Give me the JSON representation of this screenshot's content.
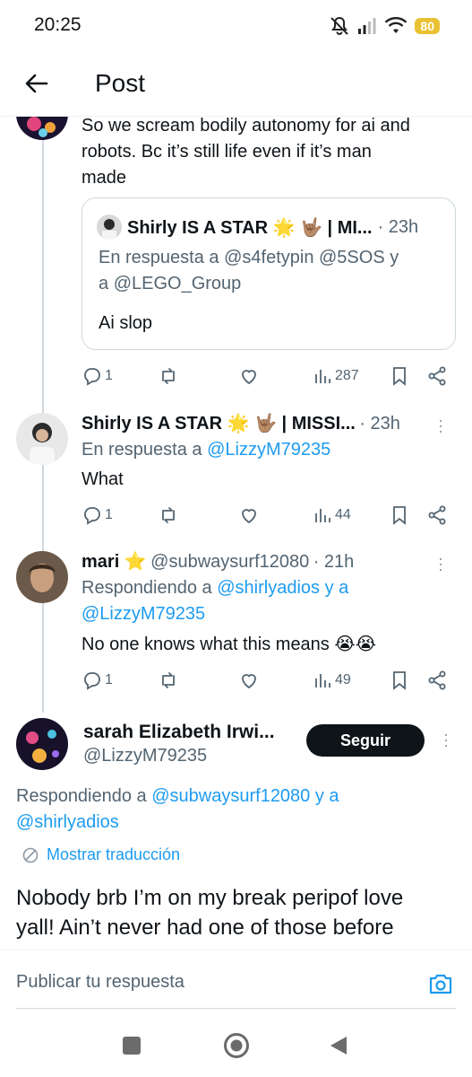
{
  "status": {
    "time": "20:25",
    "battery": "80"
  },
  "header": {
    "title": "Post"
  },
  "tweet1": {
    "text_line1": "So we scream bodily autonomy for ai and",
    "text_line2": "robots. Bc it’s still life even if it’s man",
    "text_line3": "made",
    "quote": {
      "name": "Shirly IS A STAR 🌟 🤟🏽 | MI...",
      "time": "· 23h",
      "reply_prefix": "En respuesta a ",
      "reply_handles_1": "@s4fetypin @5SOS",
      "reply_y": " y",
      "reply_line2_a": "a ",
      "reply_handles_2": "@LEGO_Group",
      "text": "Ai slop"
    },
    "replies": "1",
    "views": "287"
  },
  "tweet2": {
    "name": "Shirly IS A STAR 🌟 🤟🏽 | MISSI...",
    "time": "· 23h",
    "reply_prefix": "En respuesta a ",
    "reply_handle": "@LizzyM79235",
    "text": "What",
    "replies": "1",
    "views": "44"
  },
  "tweet3": {
    "name": "mari ⭐",
    "handle": "@subwaysurf12080",
    "time": "· 21h",
    "reply_prefix": "Respondiendo a ",
    "reply_handle_1": "@shirlyadios y a",
    "reply_handle_2": "@LizzyM79235",
    "text": "No one knows what this means 😭😭",
    "replies": "1",
    "views": "49"
  },
  "main_tweet": {
    "name": "sarah Elizabeth Irwi...",
    "handle": "@LizzyM79235",
    "follow_label": "Seguir",
    "reply_prefix": "Respondiendo a ",
    "reply_handle_1": "@subwaysurf12080 y a",
    "reply_handle_2": "@shirlyadios",
    "translate": "Mostrar traducción",
    "text_line1": "Nobody brb I’m on my break peripof love",
    "text_line2": "yall! Ain’t never had one of those before"
  },
  "reply_bar": {
    "placeholder": "Publicar tu respuesta"
  },
  "colors": {
    "accent": "#1d9bf0",
    "text": "#0f1419",
    "muted": "#536471"
  }
}
